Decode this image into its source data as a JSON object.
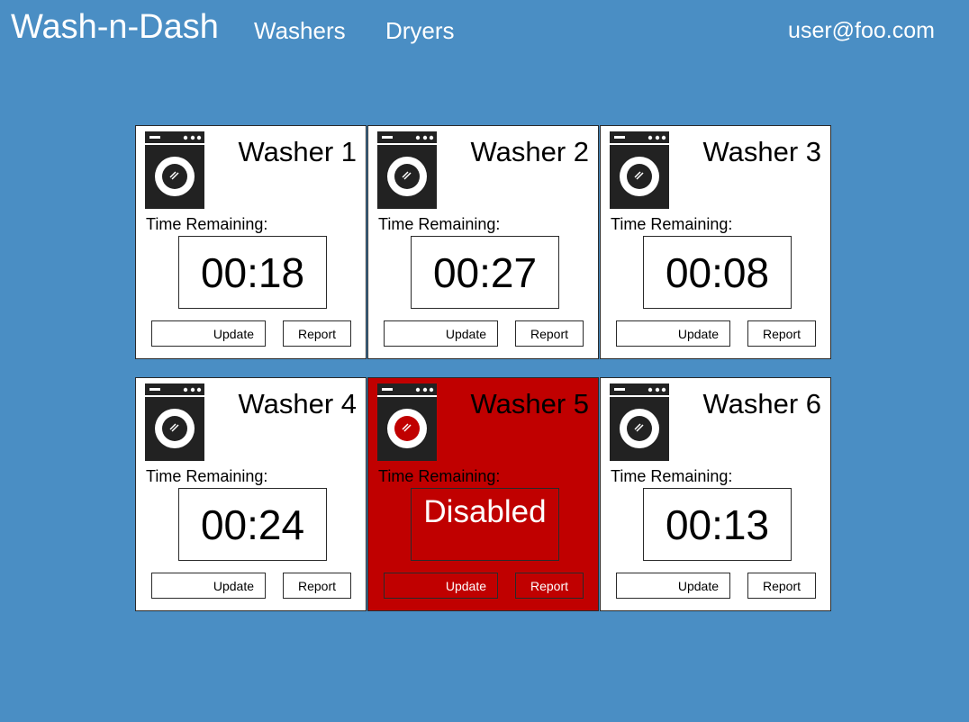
{
  "app": {
    "brand": "Wash-n-Dash",
    "nav": [
      {
        "label": "Washers"
      },
      {
        "label": "Dryers"
      }
    ],
    "user": "user@foo.com"
  },
  "colors": {
    "background": "#4a8ec4",
    "card": "#ffffff",
    "disabled_card": "#c00000",
    "disabled_icon": "#c00000",
    "icon": "#222222"
  },
  "washers": [
    {
      "name": "Washer 1",
      "time_label": "Time Remaining:",
      "time": "00:18",
      "update_label": "Update",
      "report_label": "Report",
      "icon": "washing-machine-icon",
      "status": "active"
    },
    {
      "name": "Washer 2",
      "time_label": "Time Remaining:",
      "time": "00:27",
      "update_label": "Update",
      "report_label": "Report",
      "icon": "washing-machine-icon",
      "status": "active"
    },
    {
      "name": "Washer 3",
      "time_label": "Time Remaining:",
      "time": "00:08",
      "update_label": "Update",
      "report_label": "Report",
      "icon": "washing-machine-icon",
      "status": "active"
    },
    {
      "name": "Washer 4",
      "time_label": "Time Remaining:",
      "time": "00:24",
      "update_label": "Update",
      "report_label": "Report",
      "icon": "washing-machine-icon",
      "status": "active"
    },
    {
      "name": "Washer 5",
      "time_label": "Time Remaining:",
      "time": "Disabled",
      "update_label": "Update",
      "report_label": "Report",
      "icon": "washing-machine-icon",
      "status": "disabled"
    },
    {
      "name": "Washer 6",
      "time_label": "Time Remaining:",
      "time": "00:13",
      "update_label": "Update",
      "report_label": "Report",
      "icon": "washing-machine-icon",
      "status": "active"
    }
  ]
}
